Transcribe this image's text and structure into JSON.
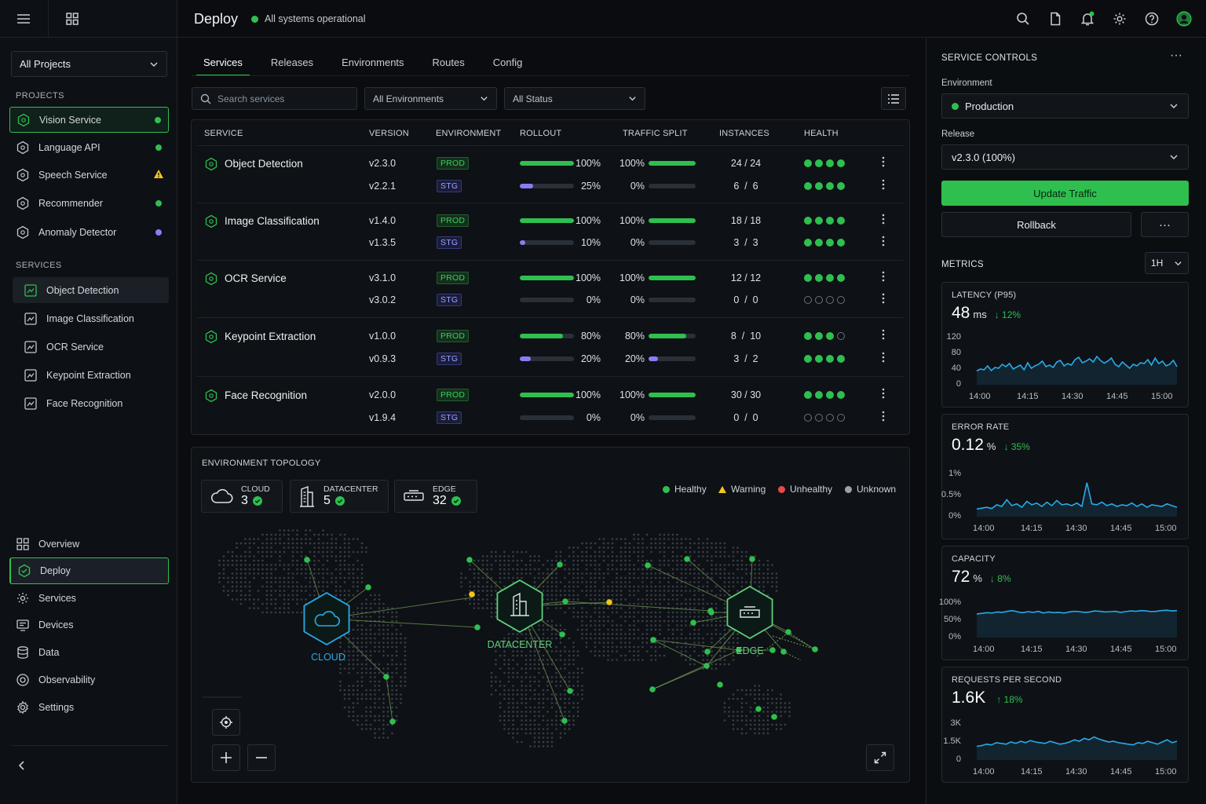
{
  "header": {
    "title": "Deploy",
    "status": "All systems operational"
  },
  "sidebar": {
    "project_select": "All Projects",
    "projects_label": "PROJECTS",
    "projects": [
      {
        "label": "Vision Service",
        "status_color": "#2fbf4f"
      },
      {
        "label": "Language API",
        "status_color": "#2fbf4f"
      },
      {
        "label": "Speech Service",
        "status_color": "#f5c518"
      },
      {
        "label": "Recommender",
        "status_color": "#2fbf4f"
      },
      {
        "label": "Anomaly Detector",
        "status_color": "#8b7cf6"
      }
    ],
    "services_label": "SERVICES",
    "services": [
      "Object Detection",
      "Image Classification",
      "OCR Service",
      "Keypoint Extraction",
      "Face Recognition"
    ],
    "nav": [
      "Overview",
      "Deploy",
      "Services",
      "Devices",
      "Data",
      "Observability",
      "Settings"
    ]
  },
  "tabs": [
    "Services",
    "Releases",
    "Environments",
    "Routes",
    "Config"
  ],
  "filters": {
    "search_placeholder": "Search services",
    "environment": "All Environments",
    "status": "All Status"
  },
  "table": {
    "headers": [
      "SERVICE",
      "VERSION",
      "ENVIRONMENT",
      "ROLLOUT",
      "TRAFFIC SPLIT",
      "INSTANCES",
      "HEALTH"
    ],
    "rows": [
      {
        "name": "Object Detection",
        "entries": [
          {
            "version": "v2.3.0",
            "env": "PROD",
            "rollout": 100,
            "rollout_label": "100%",
            "traffic": 100,
            "traffic_label": "100%",
            "instances": "24 / 24",
            "health": [
              1,
              1,
              1,
              1
            ]
          },
          {
            "version": "v2.2.1",
            "env": "STG",
            "rollout": 25,
            "rollout_label": "25%",
            "traffic": 0,
            "traffic_label": "0%",
            "instances": "6  /  6",
            "health": [
              1,
              1,
              1,
              1
            ]
          }
        ]
      },
      {
        "name": "Image Classification",
        "entries": [
          {
            "version": "v1.4.0",
            "env": "PROD",
            "rollout": 100,
            "rollout_label": "100%",
            "traffic": 100,
            "traffic_label": "100%",
            "instances": "18 / 18",
            "health": [
              1,
              1,
              1,
              1
            ]
          },
          {
            "version": "v1.3.5",
            "env": "STG",
            "rollout": 10,
            "rollout_label": "10%",
            "traffic": 0,
            "traffic_label": "0%",
            "instances": "3  /  3",
            "health": [
              1,
              1,
              1,
              1
            ]
          }
        ]
      },
      {
        "name": "OCR Service",
        "entries": [
          {
            "version": "v3.1.0",
            "env": "PROD",
            "rollout": 100,
            "rollout_label": "100%",
            "traffic": 100,
            "traffic_label": "100%",
            "instances": "12 / 12",
            "health": [
              1,
              1,
              1,
              1
            ]
          },
          {
            "version": "v3.0.2",
            "env": "STG",
            "rollout": 0,
            "rollout_label": "0%",
            "traffic": 0,
            "traffic_label": "0%",
            "instances": "0  /  0",
            "health": [
              0,
              0,
              0,
              0
            ]
          }
        ]
      },
      {
        "name": "Keypoint Extraction",
        "entries": [
          {
            "version": "v1.0.0",
            "env": "PROD",
            "rollout": 80,
            "rollout_label": "80%",
            "traffic": 80,
            "traffic_label": "80%",
            "instances": "8  /  10",
            "health": [
              1,
              1,
              1,
              0
            ]
          },
          {
            "version": "v0.9.3",
            "env": "STG",
            "rollout": 20,
            "rollout_label": "20%",
            "traffic": 20,
            "traffic_label": "20%",
            "instances": "3  /  2",
            "health": [
              1,
              1,
              1,
              1
            ]
          }
        ]
      },
      {
        "name": "Face Recognition",
        "entries": [
          {
            "version": "v2.0.0",
            "env": "PROD",
            "rollout": 100,
            "rollout_label": "100%",
            "traffic": 100,
            "traffic_label": "100%",
            "instances": "30 / 30",
            "health": [
              1,
              1,
              1,
              1
            ]
          },
          {
            "version": "v1.9.4",
            "env": "STG",
            "rollout": 0,
            "rollout_label": "0%",
            "traffic": 0,
            "traffic_label": "0%",
            "instances": "0  /  0",
            "health": [
              0,
              0,
              0,
              0
            ]
          }
        ]
      }
    ]
  },
  "topology": {
    "title": "ENVIRONMENT TOPOLOGY",
    "chips": [
      {
        "label": "CLOUD",
        "count": "3"
      },
      {
        "label": "DATACENTER",
        "count": "5"
      },
      {
        "label": "EDGE",
        "count": "32"
      }
    ],
    "legend": [
      {
        "label": "Healthy",
        "color": "#2fbf4f"
      },
      {
        "label": "Warning",
        "color": "#f5c518"
      },
      {
        "label": "Unhealthy",
        "color": "#e5484d"
      },
      {
        "label": "Unknown",
        "color": "#9aa1a9"
      }
    ],
    "hubs": {
      "cloud": "CLOUD",
      "datacenter": "DATACENTER",
      "edge": "EDGE"
    }
  },
  "controls": {
    "title": "SERVICE CONTROLS",
    "env_label": "Environment",
    "env_value": "Production",
    "release_label": "Release",
    "release_value": "v2.3.0 (100%)",
    "update_button": "Update Traffic",
    "rollback_button": "Rollback",
    "more_button": "···"
  },
  "metrics": {
    "title": "METRICS",
    "range": "1H",
    "x_ticks": [
      "14:00",
      "14:15",
      "14:30",
      "14:45",
      "15:00"
    ],
    "cards": [
      {
        "title": "LATENCY (P95)",
        "value": "48",
        "unit": "ms",
        "delta": "↓ 12%",
        "y_ticks": [
          "120",
          "80",
          "40",
          "0"
        ]
      },
      {
        "title": "ERROR RATE",
        "value": "0.12",
        "unit": "%",
        "delta": "↓ 35%",
        "y_ticks": [
          "1%",
          "0.5%",
          "0%"
        ]
      },
      {
        "title": "CAPACITY",
        "value": "72",
        "unit": "%",
        "delta": "↓ 8%",
        "y_ticks": [
          "100%",
          "50%",
          "0%"
        ]
      },
      {
        "title": "REQUESTS PER SECOND",
        "value": "1.6K",
        "unit": "",
        "delta": "↑ 18%",
        "y_ticks": [
          "3K",
          "1.5K",
          "0"
        ]
      }
    ]
  },
  "colors": {
    "accent": "#2fbf4f",
    "staging": "#8b7cf6",
    "chart_line": "#2aa9e8"
  }
}
